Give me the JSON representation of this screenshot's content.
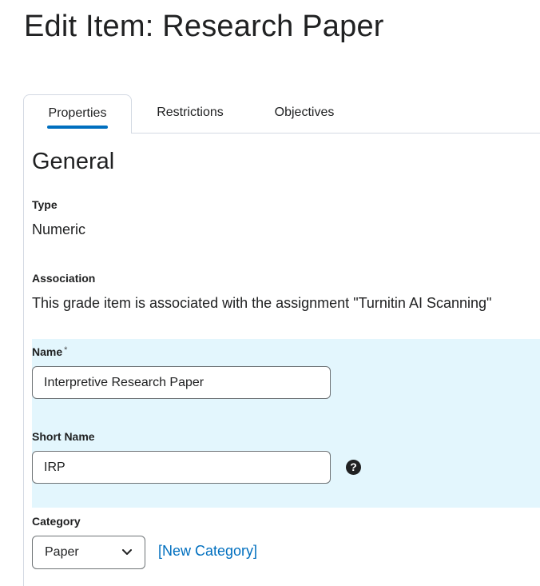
{
  "page": {
    "title": "Edit Item: Research Paper"
  },
  "tabs": [
    {
      "label": "Properties",
      "active": true
    },
    {
      "label": "Restrictions",
      "active": false
    },
    {
      "label": "Objectives",
      "active": false
    }
  ],
  "general": {
    "heading": "General",
    "type_label": "Type",
    "type_value": "Numeric",
    "association_label": "Association",
    "association_value": "This grade item is associated with the assignment \"Turnitin AI Scanning\"",
    "name_label": "Name",
    "name_required_mark": "*",
    "name_value": "Interpretive Research Paper",
    "short_name_label": "Short Name",
    "short_name_value": "IRP",
    "help_icon": "question-circle-icon",
    "category_label": "Category",
    "category_value": "Paper",
    "category_dropdown_icon": "chevron-down-icon",
    "new_category_link": "[New Category]"
  },
  "colors": {
    "accent": "#006fbf",
    "highlight_bg": "#e3f6fd",
    "border": "#d3d9e3",
    "text": "#202122"
  }
}
